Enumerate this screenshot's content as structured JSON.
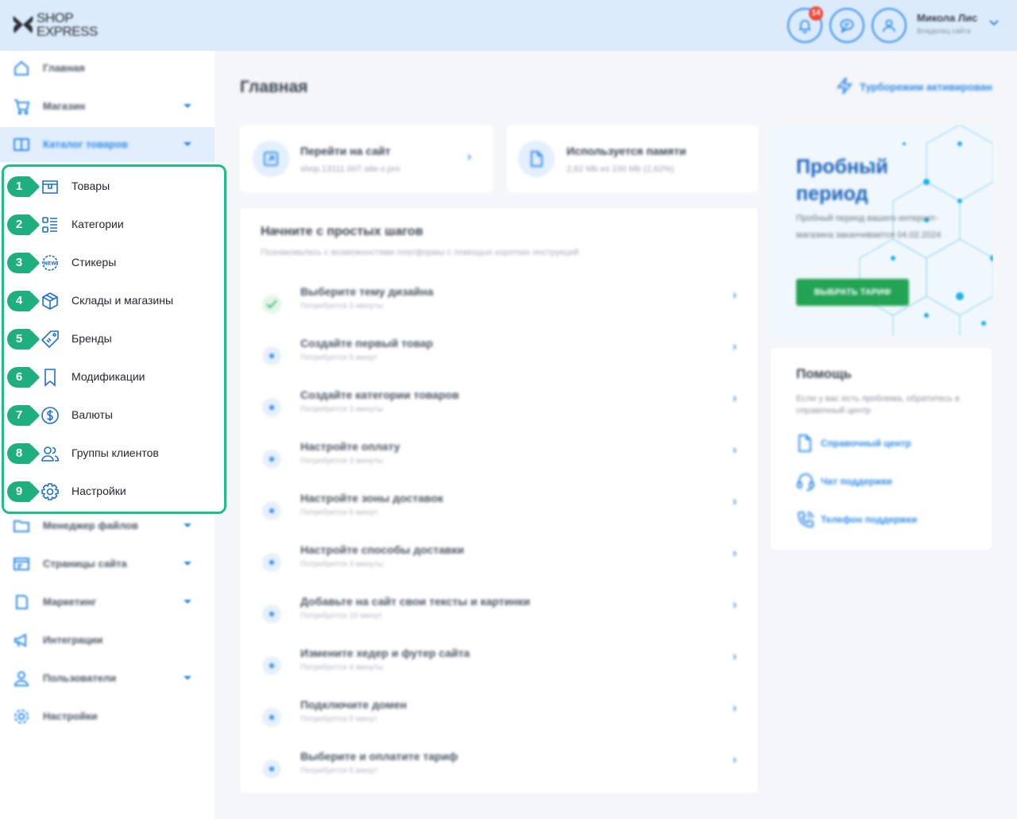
{
  "header": {
    "logo_line1": "SHOP",
    "logo_line2": "EXPRESS",
    "notification_count": "14",
    "user_name": "Микола Лис",
    "user_role": "Владелец сайта"
  },
  "sidebar": {
    "items_top": [
      {
        "label": "Главная",
        "icon": "home-icon",
        "has_chevron": false
      },
      {
        "label": "Магазин",
        "icon": "cart-icon",
        "has_chevron": true
      },
      {
        "label": "Каталог товаров",
        "icon": "catalog-icon",
        "has_chevron": true,
        "active": true
      }
    ],
    "submenu": [
      {
        "num": "1",
        "label": "Товары",
        "icon": "box-store-icon"
      },
      {
        "num": "2",
        "label": "Категории",
        "icon": "category-list-icon"
      },
      {
        "num": "3",
        "label": "Стикеры",
        "icon": "sticker-new-icon"
      },
      {
        "num": "4",
        "label": "Склады и магазины",
        "icon": "warehouse-cube-icon"
      },
      {
        "num": "5",
        "label": "Бренды",
        "icon": "brand-tag-icon"
      },
      {
        "num": "6",
        "label": "Модификации",
        "icon": "bookmark-icon"
      },
      {
        "num": "7",
        "label": "Валюты",
        "icon": "dollar-icon"
      },
      {
        "num": "8",
        "label": "Группы клиентов",
        "icon": "users-icon"
      },
      {
        "num": "9",
        "label": "Настройки",
        "icon": "gear-icon"
      }
    ],
    "items_bottom": [
      {
        "label": "Менеджер файлов",
        "icon": "folder-icon",
        "has_chevron": true
      },
      {
        "label": "Страницы сайта",
        "icon": "pages-icon",
        "has_chevron": true
      },
      {
        "label": "Маркетинг",
        "icon": "marketing-icon",
        "has_chevron": true
      },
      {
        "label": "Интеграции",
        "icon": "megaphone-icon",
        "has_chevron": false
      },
      {
        "label": "Пользователи",
        "icon": "user-icon",
        "has_chevron": true
      },
      {
        "label": "Настройки",
        "icon": "settings-icon",
        "has_chevron": false
      }
    ]
  },
  "main": {
    "title": "Главная",
    "turbo": "Турборежим активирован",
    "site_card": {
      "title": "Перейти на сайт",
      "sub": "shop.13111.007.site-x.pro"
    },
    "memory_card": {
      "title": "Используется памяти",
      "sub": "2,62 Mb из 100 Mb (2,62%)"
    },
    "steps_title": "Начните с простых шагов",
    "steps_sub": "Познакомьтесь с возможностями платформы с помощью коротких инструкций",
    "steps": [
      {
        "title": "Выберите тему дизайна",
        "sub": "Потребуется 3 минуты",
        "done": true
      },
      {
        "title": "Создайте первый товар",
        "sub": "Потребуется 5 минут",
        "done": false
      },
      {
        "title": "Создайте категории товаров",
        "sub": "Потребуется 3 минуты",
        "done": false
      },
      {
        "title": "Настройте оплату",
        "sub": "Потребуется 3 минуты",
        "done": false
      },
      {
        "title": "Настройте зоны доставок",
        "sub": "Потребуется 6 минут",
        "done": false
      },
      {
        "title": "Настройте способы доставки",
        "sub": "Потребуется 3 минуты",
        "done": false
      },
      {
        "title": "Добавьте на сайт свои тексты и картинки",
        "sub": "Потребуется 10 минут",
        "done": false
      },
      {
        "title": "Измените хедер и футер сайта",
        "sub": "Потребуется 4 минуты",
        "done": false
      },
      {
        "title": "Подключите домен",
        "sub": "Потребуется 5 минут",
        "done": false
      },
      {
        "title": "Выберите и оплатите тариф",
        "sub": "Потребуется 6 минут",
        "done": false
      }
    ]
  },
  "trial": {
    "title_line1": "Пробный",
    "title_line2": "период",
    "text": "Пробный период вашего интернет-магазина заканчивается 04.02.2024",
    "button": "ВЫБРАТЬ ТАРИФ"
  },
  "help": {
    "title": "Помощь",
    "text": "Если у вас есть проблема, обратитесь в справочный центр",
    "links": [
      {
        "label": "Справочный центр",
        "icon": "document-icon"
      },
      {
        "label": "Чат поддержки",
        "icon": "headset-icon"
      },
      {
        "label": "Телефон поддержки",
        "icon": "phone-icon"
      }
    ]
  },
  "colors": {
    "accent": "#2f8be6",
    "highlight_border": "#1fbd88",
    "badge": "#f04b3a",
    "button_green": "#23a455"
  }
}
